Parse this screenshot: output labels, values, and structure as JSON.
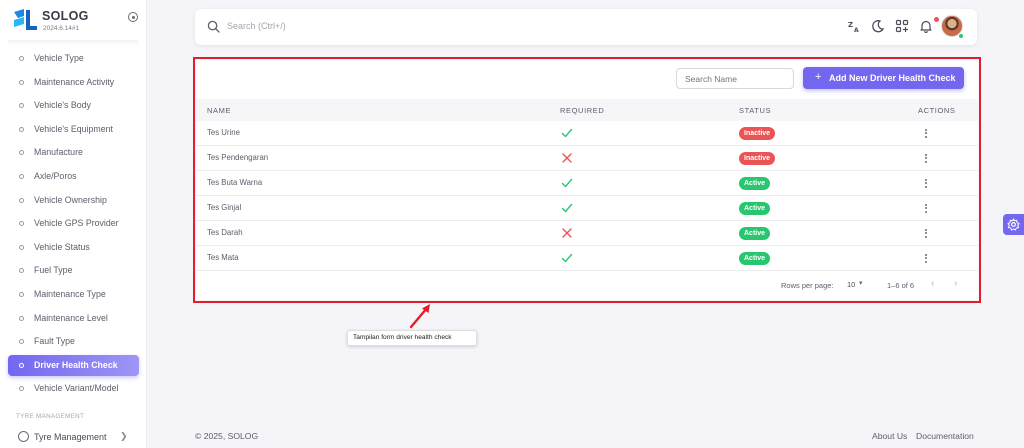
{
  "brand": {
    "name": "SOLOG",
    "version": "2024.6.14#1"
  },
  "sidebar": {
    "items": [
      {
        "label": "Vehicle Type"
      },
      {
        "label": "Maintenance Activity"
      },
      {
        "label": "Vehicle's Body"
      },
      {
        "label": "Vehicle's Equipment"
      },
      {
        "label": "Manufacture"
      },
      {
        "label": "Axle/Poros"
      },
      {
        "label": "Vehicle Ownership"
      },
      {
        "label": "Vehicle GPS Provider"
      },
      {
        "label": "Vehicle Status"
      },
      {
        "label": "Fuel Type"
      },
      {
        "label": "Maintenance Type"
      },
      {
        "label": "Maintenance Level"
      },
      {
        "label": "Fault Type"
      },
      {
        "label": "Driver Health Check",
        "active": true
      },
      {
        "label": "Vehicle Variant/Model"
      }
    ],
    "section_label": "TYRE MANAGEMENT",
    "tyre_item": "Tyre Management"
  },
  "topbar": {
    "search_placeholder": "Search (Ctrl+/)",
    "icons": [
      "translate-icon",
      "moon-icon",
      "apps-icon",
      "bell-icon"
    ]
  },
  "table": {
    "search_placeholder": "Search Name",
    "add_button": "Add New Driver Health Check",
    "headers": {
      "name": "NAME",
      "required": "REQUIRED",
      "status": "STATUS",
      "actions": "ACTIONS"
    },
    "rows": [
      {
        "name": "Tes Urine",
        "required": true,
        "status": "Inactive"
      },
      {
        "name": "Tes Pendengaran",
        "required": false,
        "status": "Inactive"
      },
      {
        "name": "Tes Buta Warna",
        "required": true,
        "status": "Active"
      },
      {
        "name": "Tes Ginjal",
        "required": true,
        "status": "Active"
      },
      {
        "name": "Tes Darah",
        "required": false,
        "status": "Active"
      },
      {
        "name": "Tes Mata",
        "required": true,
        "status": "Active"
      }
    ],
    "pagination": {
      "rows_per_page_label": "Rows per page:",
      "rows_per_page": "10",
      "range": "1–6 of 6"
    }
  },
  "annotation": {
    "text": "Tampilan form driver health check"
  },
  "colors": {
    "primary": "#7367f0",
    "success": "#28c76f",
    "danger": "#ea5455",
    "highlight": "#e31d2b"
  },
  "footer": {
    "copyright": "© 2025, SOLOG",
    "links": [
      "About Us",
      "Documentation"
    ]
  }
}
